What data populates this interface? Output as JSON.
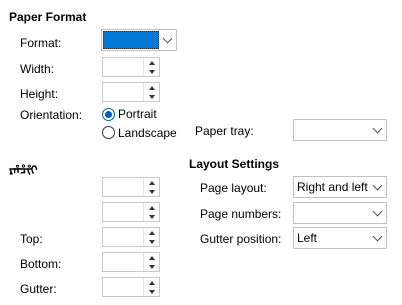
{
  "paper_format": {
    "heading": "Paper Format",
    "format_label": "Format:",
    "format_value": "",
    "width_label": "Width:",
    "width_value": "",
    "height_label": "Height:",
    "height_value": "",
    "orientation_label": "Orientation:",
    "portrait_label": "Portrait",
    "landscape_label": "Landscape",
    "orientation_selected": "Portrait",
    "paper_tray_label": "Paper tray:",
    "paper_tray_value": ""
  },
  "margins": {
    "heading": "ᡵᡥᡱᡲᡳ",
    "inner_value": "",
    "outer_value": "",
    "top_label": "Top:",
    "top_value": "",
    "bottom_label": "Bottom:",
    "bottom_value": "",
    "gutter_label": "Gutter:",
    "gutter_value": ""
  },
  "layout_settings": {
    "heading": "Layout Settings",
    "page_layout_label": "Page layout:",
    "page_layout_value": "Right and left",
    "page_numbers_label": "Page numbers:",
    "page_numbers_value": "",
    "gutter_position_label": "Gutter position:",
    "gutter_position_value": "Left"
  },
  "colors": {
    "selection": "#0078d7",
    "accent": "#005fb8"
  }
}
